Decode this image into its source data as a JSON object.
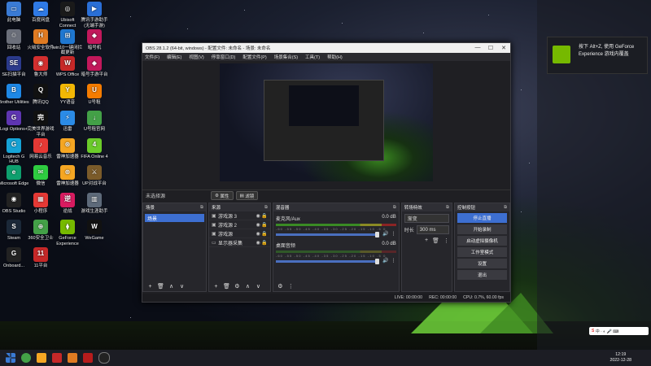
{
  "desktop_icons": [
    {
      "label": "此电脑",
      "color": "#3a7bd5",
      "glyph": "▭"
    },
    {
      "label": "百度网盘",
      "color": "#2f7ae5",
      "glyph": "☁"
    },
    {
      "label": "Ubisoft Connect",
      "color": "#1a1a1a",
      "glyph": "◎"
    },
    {
      "label": "腾讯手游助手 (无端手游)",
      "color": "#2a6fd6",
      "glyph": "▶"
    },
    {
      "label": "回收站",
      "color": "#6b6f7a",
      "glyph": "♲"
    },
    {
      "label": "火绒安全软件",
      "color": "#e07b22",
      "glyph": "H"
    },
    {
      "label": "win10一键闭拦截更新",
      "color": "#1f77d0",
      "glyph": "⊞"
    },
    {
      "label": "暗号机",
      "color": "#c2185b",
      "glyph": "◆"
    },
    {
      "label": "SE扫描平台",
      "color": "#2b3a8c",
      "glyph": "SE"
    },
    {
      "label": "鲁大师",
      "color": "#d32f2f",
      "glyph": "◉"
    },
    {
      "label": "WPS Office",
      "color": "#c62828",
      "glyph": "W"
    },
    {
      "label": "暗号手游平台",
      "color": "#c2185b",
      "glyph": "◆"
    },
    {
      "label": "Brother Utilities",
      "color": "#1e88e5",
      "glyph": "B"
    },
    {
      "label": "腾讯QQ",
      "color": "#111",
      "glyph": "Q"
    },
    {
      "label": "YY语音",
      "color": "#f2b705",
      "glyph": "Y"
    },
    {
      "label": "U号租",
      "color": "#f57c00",
      "glyph": "U"
    },
    {
      "label": "Logi Options+",
      "color": "#5e35b1",
      "glyph": "G"
    },
    {
      "label": "完美世界游戏平台",
      "color": "#111",
      "glyph": "完"
    },
    {
      "label": "迅雷",
      "color": "#2b8be6",
      "glyph": "⚡"
    },
    {
      "label": "U号租官网",
      "color": "#43a047",
      "glyph": "↓"
    },
    {
      "label": "Logitech G HUB",
      "color": "#16a3d6",
      "glyph": "G"
    },
    {
      "label": "网易云音乐",
      "color": "#e53935",
      "glyph": "♪"
    },
    {
      "label": "雷神加速器",
      "color": "#f5a623",
      "glyph": "⊛"
    },
    {
      "label": "FIFA Online 4",
      "color": "#6bcb2a",
      "glyph": "4"
    },
    {
      "label": "Microsoft Edge",
      "color": "#0e9f6e",
      "glyph": "e"
    },
    {
      "label": "微信",
      "color": "#2ecc40",
      "glyph": "✉"
    },
    {
      "label": "雷神加速器",
      "color": "#f5a623",
      "glyph": "⊛"
    },
    {
      "label": "UP对战平台",
      "color": "#7b5b2a",
      "glyph": "⚔"
    },
    {
      "label": "OBS Studio",
      "color": "#222",
      "glyph": "◉"
    },
    {
      "label": "小程序",
      "color": "#e53935",
      "glyph": "▦"
    },
    {
      "label": "逆战",
      "color": "#d81b60",
      "glyph": "逆"
    },
    {
      "label": "游戏生涯助手",
      "color": "#5e6a7a",
      "glyph": "▥"
    },
    {
      "label": "Steam",
      "color": "#1b2838",
      "glyph": "S"
    },
    {
      "label": "360安全卫士",
      "color": "#43a047",
      "glyph": "⊕"
    },
    {
      "label": "GeForce Experience",
      "color": "#76b900",
      "glyph": "⧫"
    },
    {
      "label": "WeGame",
      "color": "#111",
      "glyph": "W"
    },
    {
      "label": "Onboard...",
      "color": "#222",
      "glyph": "G"
    },
    {
      "label": "11平台",
      "color": "#c62828",
      "glyph": "11"
    }
  ],
  "obs": {
    "title": "OBS 28.1.2 (64-bit, windows) - 配置文件: 未命名 - 场景: 未命名",
    "menu": [
      "文件(F)",
      "编辑(E)",
      "视图(V)",
      "停靠窗口(D)",
      "配置文件(P)",
      "场景集合(S)",
      "工具(T)",
      "帮助(H)"
    ],
    "preview_label": "未选择源",
    "prop_button": "属性",
    "filter_button": "滤镜",
    "scenes_title": "场景",
    "scene_selected": "场景",
    "sources_title": "来源",
    "sources": [
      "游戏源 3",
      "游戏源 2",
      "游戏源",
      "显示器采集"
    ],
    "mixer_title": "混音器",
    "mixer": [
      {
        "name": "麦克风/Aux",
        "db": "0.0 dB"
      },
      {
        "name": "桌面音频",
        "db": "0.0 dB"
      }
    ],
    "meter_scale": "-60 -55 -50 -45 -40 -35 -30 -25 -20 -15 -10 -5 0",
    "transitions_title": "转场特效",
    "transition_type": "渐变",
    "duration_label": "时长",
    "duration_value": "300 ms",
    "controls_title": "控制按钮",
    "controls": [
      "停止直播",
      "开始录制",
      "启动虚拟摄像机",
      "工作室模式",
      "设置",
      "退出"
    ],
    "status": {
      "live": "LIVE: 00:00:00",
      "rec": "REC: 00:00:00",
      "cpu": "CPU: 0.7%, 60.00 fps"
    }
  },
  "notification": {
    "text": "按下 Alt+Z, 使用 GeForce Experience 游戏内覆盖"
  },
  "tray": {
    "time": "12:19",
    "date": "2022-12-28"
  }
}
